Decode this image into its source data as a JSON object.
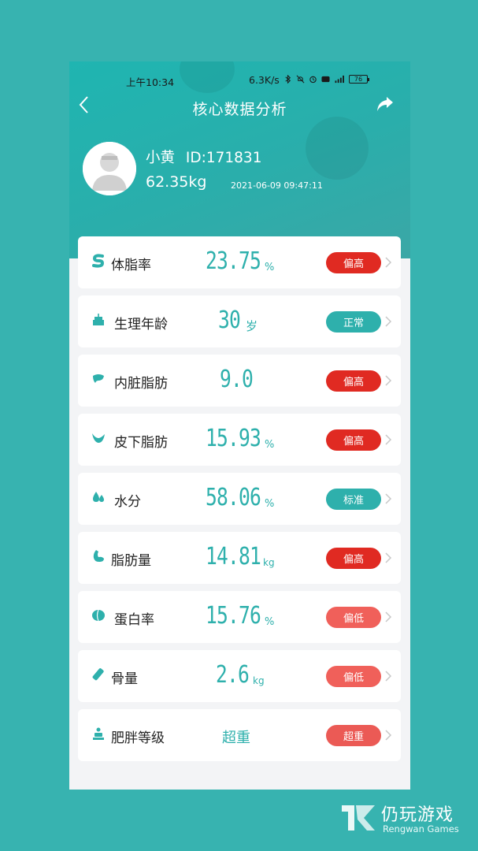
{
  "status_bar": {
    "time": "上午10:34",
    "speed": "6.3K/s",
    "battery": "76"
  },
  "header": {
    "title": "核心数据分析"
  },
  "user": {
    "name": "小黄",
    "id_label": "ID:171831",
    "weight": "62.35kg",
    "datetime": "2021-06-09 09:47:11"
  },
  "metrics": [
    {
      "label": "体脂率",
      "value": "23.75",
      "unit": "%",
      "status": "偏高",
      "status_color": "#e02a22",
      "icon": "body-fat-icon"
    },
    {
      "label": "生理年龄",
      "value": "30",
      "unit": "岁",
      "status": "正常",
      "status_color": "#2eb0ac",
      "icon": "cake-icon"
    },
    {
      "label": "内脏脂肪",
      "value": "9.0",
      "unit": "",
      "status": "偏高",
      "status_color": "#e02a22",
      "icon": "organ-icon"
    },
    {
      "label": "皮下脂肪",
      "value": "15.93",
      "unit": "%",
      "status": "偏高",
      "status_color": "#e02a22",
      "icon": "subcutaneous-icon"
    },
    {
      "label": "水分",
      "value": "58.06",
      "unit": "%",
      "status": "标准",
      "status_color": "#2eb0ac",
      "icon": "water-drop-icon"
    },
    {
      "label": "脂肪量",
      "value": "14.81",
      "unit": "kg",
      "status": "偏高",
      "status_color": "#e02a22",
      "icon": "fat-mass-icon"
    },
    {
      "label": "蛋白率",
      "value": "15.76",
      "unit": "%",
      "status": "偏低",
      "status_color": "#f0605a",
      "icon": "protein-icon"
    },
    {
      "label": "骨量",
      "value": "2.6",
      "unit": "kg",
      "status": "偏低",
      "status_color": "#f0605a",
      "icon": "bone-icon"
    },
    {
      "label": "肥胖等级",
      "value": "超重",
      "unit": "",
      "status": "超重",
      "status_color": "#eb5a55",
      "icon": "obesity-icon"
    }
  ],
  "watermark": {
    "title": "仍玩游戏",
    "subtitle": "Rengwan Games"
  }
}
